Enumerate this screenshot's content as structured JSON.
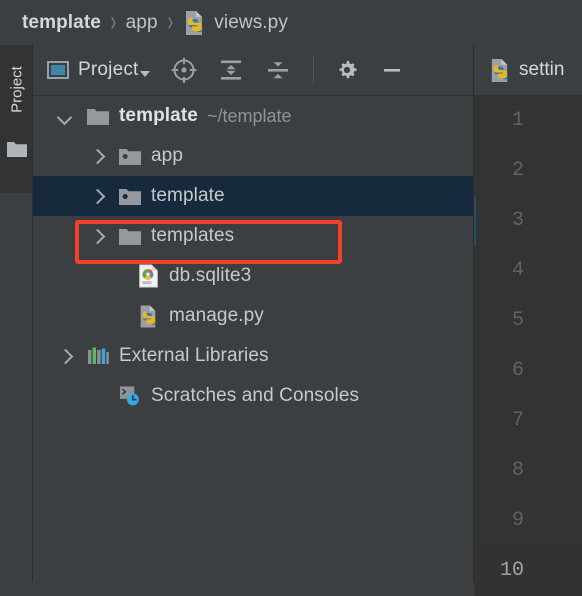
{
  "breadcrumb": {
    "items": [
      {
        "label": "template",
        "icon": "none",
        "bold": true
      },
      {
        "label": "app",
        "icon": "none",
        "bold": false
      },
      {
        "label": "views.py",
        "icon": "python-file-icon",
        "bold": false
      }
    ],
    "separator": "›"
  },
  "tool_strip": {
    "label": "Project",
    "icon": "folder-icon"
  },
  "panel_toolbar": {
    "project_button_label": "Project",
    "project_button_icon": "project-view-icon",
    "caret_icon": "chevron-down-icon",
    "buttons": [
      {
        "name": "select-opened-file-icon",
        "title": "Select Opened File"
      },
      {
        "name": "expand-all-icon",
        "title": "Expand All"
      },
      {
        "name": "collapse-all-icon",
        "title": "Collapse All"
      },
      {
        "name": "settings-gear-icon",
        "title": "Settings"
      },
      {
        "name": "hide-panel-icon",
        "title": "Hide"
      }
    ]
  },
  "tree": {
    "rows": [
      {
        "label": "template",
        "sublabel": "~/template",
        "icon": "folder-icon",
        "arrow": "down",
        "indent": 24,
        "bold": true,
        "selected": false
      },
      {
        "label": "app",
        "sublabel": "",
        "icon": "module-folder-icon",
        "arrow": "right",
        "indent": 56,
        "bold": false,
        "selected": false
      },
      {
        "label": "template",
        "sublabel": "",
        "icon": "module-folder-icon",
        "arrow": "right",
        "indent": 56,
        "bold": false,
        "selected": true
      },
      {
        "label": "templates",
        "sublabel": "",
        "icon": "folder-icon",
        "arrow": "right",
        "indent": 56,
        "bold": false,
        "selected": false
      },
      {
        "label": "db.sqlite3",
        "sublabel": "",
        "icon": "sqlite-file-icon",
        "arrow": "none",
        "indent": 88,
        "bold": false,
        "selected": false
      },
      {
        "label": "manage.py",
        "sublabel": "",
        "icon": "python-file-icon",
        "arrow": "none",
        "indent": 88,
        "bold": false,
        "selected": false
      },
      {
        "label": "External Libraries",
        "sublabel": "",
        "icon": "external-libraries-icon",
        "arrow": "right",
        "indent": 24,
        "bold": false,
        "selected": false
      },
      {
        "label": "Scratches and Consoles",
        "sublabel": "",
        "icon": "scratches-consoles-icon",
        "arrow": "none",
        "indent": 56,
        "bold": false,
        "selected": false
      }
    ]
  },
  "annotation": {
    "target_label": "templates",
    "color": "#f4402a"
  },
  "editor": {
    "tab_label": "settin",
    "tab_icon": "python-file-icon",
    "line_numbers": [
      "1",
      "2",
      "3",
      "4",
      "5",
      "6",
      "7",
      "8",
      "9",
      "10"
    ],
    "current_line": "10"
  },
  "colors": {
    "background": "#3c3f41",
    "panel_dark": "#313335",
    "selection": "#17293d",
    "accent_blue": "#3d87a8",
    "annotation_red": "#f4402a",
    "text": "#c6cacd"
  }
}
